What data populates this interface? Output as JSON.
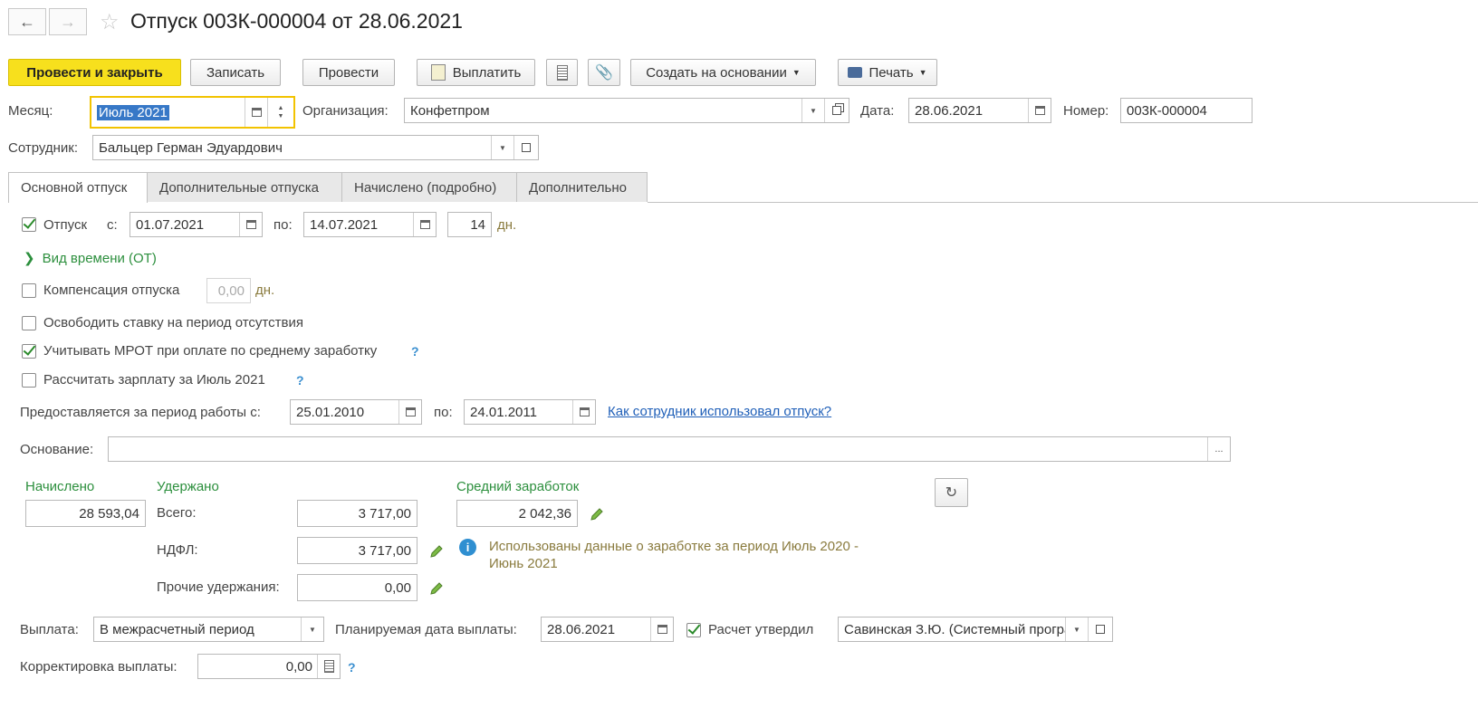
{
  "title": "Отпуск 003К-000004 от 28.06.2021",
  "toolbar": {
    "post_close": "Провести и закрыть",
    "save": "Записать",
    "post": "Провести",
    "pay": "Выплатить",
    "create_based": "Создать на основании",
    "print": "Печать"
  },
  "header": {
    "month_label": "Месяц:",
    "month_value": "Июль 2021",
    "org_label": "Организация:",
    "org_value": "Конфетпром",
    "date_label": "Дата:",
    "date_value": "28.06.2021",
    "number_label": "Номер:",
    "number_value": "003К-000004",
    "employee_label": "Сотрудник:",
    "employee_value": "Бальцер Герман Эдуардович"
  },
  "tabs": [
    "Основной отпуск",
    "Дополнительные отпуска",
    "Начислено (подробно)",
    "Дополнительно"
  ],
  "vacation": {
    "label": "Отпуск",
    "from_label": "с:",
    "from_value": "01.07.2021",
    "to_label": "по:",
    "to_value": "14.07.2021",
    "days_value": "14",
    "days_unit": "дн.",
    "time_type": "Вид времени (ОТ)"
  },
  "compensation": {
    "label": "Компенсация отпуска",
    "value": "0,00",
    "unit": "дн."
  },
  "release_rate": "Освободить ставку на период отсутствия",
  "mrot": "Учитывать МРОТ при оплате по среднему заработку",
  "calc_salary": "Рассчитать зарплату за Июль 2021",
  "period": {
    "label": "Предоставляется за период работы с:",
    "from_value": "25.01.2010",
    "to_label": "по:",
    "to_value": "24.01.2011",
    "link": "Как сотрудник использовал отпуск?"
  },
  "basis": {
    "label": "Основание:",
    "value": "",
    "btn": "..."
  },
  "accrued": {
    "title": "Начислено",
    "value": "28 593,04"
  },
  "withheld": {
    "title": "Удержано",
    "total_label": "Всего:",
    "total_value": "3 717,00",
    "ndfl_label": "НДФЛ:",
    "ndfl_value": "3 717,00",
    "other_label": "Прочие удержания:",
    "other_value": "0,00"
  },
  "average": {
    "title": "Средний заработок",
    "value": "2 042,36",
    "info": "Использованы данные о заработке за период Июль 2020 - Июнь 2021"
  },
  "payment": {
    "label": "Выплата:",
    "value": "В межрасчетный период",
    "planned_label": "Планируемая дата выплаты:",
    "planned_value": "28.06.2021",
    "approved_label": "Расчет утвердил",
    "approved_value": "Савинская З.Ю. (Системный программист)"
  },
  "correction": {
    "label": "Корректировка выплаты:",
    "value": "0,00"
  },
  "help_mark": "?"
}
